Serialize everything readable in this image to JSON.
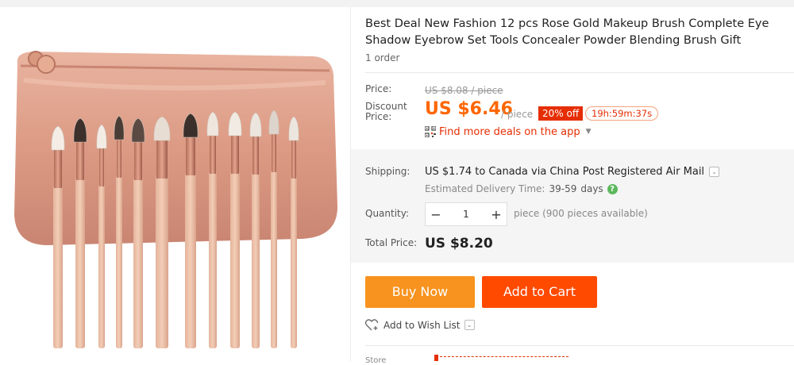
{
  "product": {
    "title": "Best Deal New Fashion 12 pcs Rose Gold Makeup Brush Complete Eye Shadow Eyebrow Set Tools Concealer Powder Blending Brush Gift",
    "orders": "1 order"
  },
  "price": {
    "label": "Price:",
    "original": "US $8.08 / piece",
    "discount_label_line1": "Discount",
    "discount_label_line2": "Price:",
    "current": "US $6.46",
    "per_unit": "/ piece",
    "discount_badge": "20% off",
    "countdown": "19h:59m:37s",
    "app_deals": "Find more deals on the app"
  },
  "shipping": {
    "label": "Shipping:",
    "value": "US $1.74 to Canada via China Post Registered Air Mail",
    "delivery_label": "Estimated Delivery Time:",
    "delivery_days": "39-59",
    "delivery_unit": "days"
  },
  "quantity": {
    "label": "Quantity:",
    "value": "1",
    "minus": "−",
    "plus": "+",
    "available": "piece (900 pieces available)"
  },
  "total": {
    "label": "Total Price:",
    "value": "US $8.20"
  },
  "actions": {
    "buy_now": "Buy Now",
    "add_to_cart": "Add to Cart",
    "wishlist": "Add to Wish List"
  },
  "store": {
    "label": "Store"
  },
  "colors": {
    "accent_orange": "#ff4a00",
    "buy_orange": "#f7931e",
    "price_orange": "#f60",
    "badge_red": "#e62e04"
  }
}
